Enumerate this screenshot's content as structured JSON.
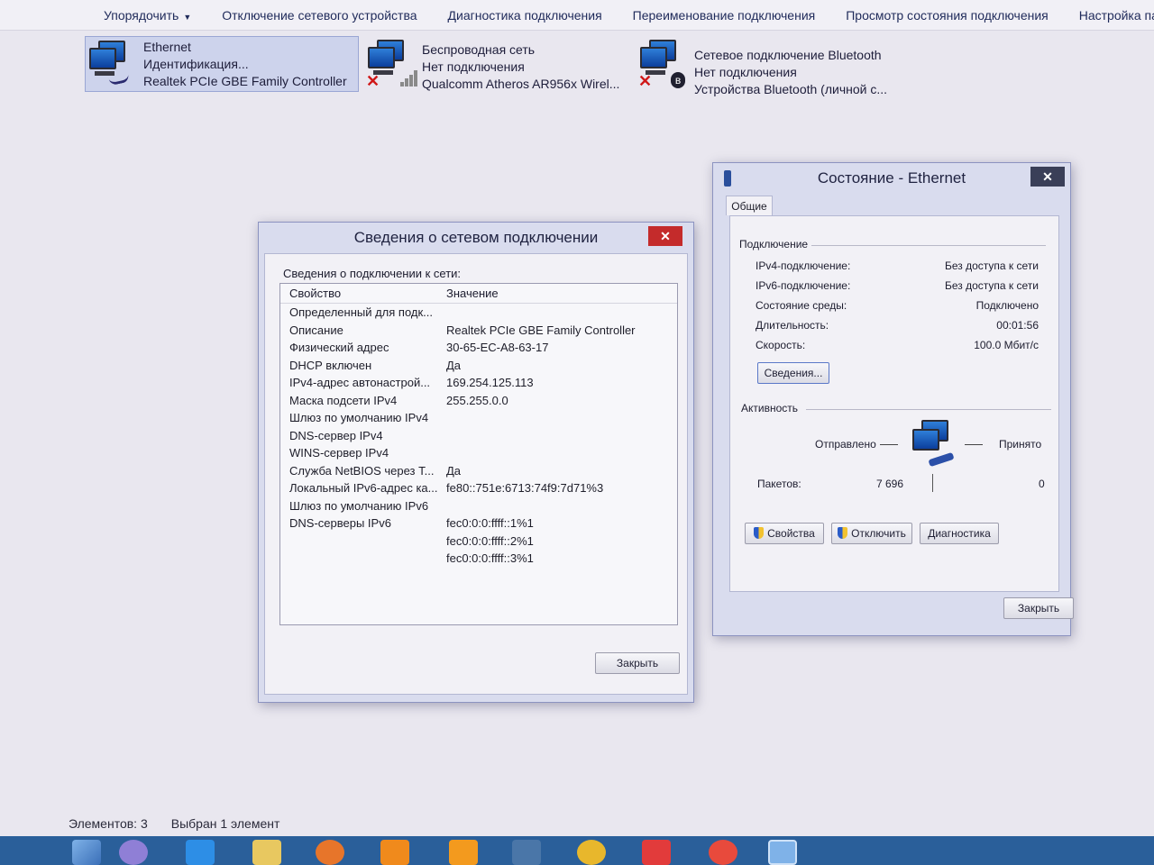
{
  "toolbar": {
    "organize": "Упорядочить",
    "disable_device": "Отключение сетевого устройства",
    "diagnose": "Диагностика подключения",
    "rename": "Переименование подключения",
    "view_status": "Просмотр состояния подключения",
    "settings": "Настройка па"
  },
  "adapters": [
    {
      "name": "Ethernet",
      "status": "Идентификация...",
      "device": "Realtek PCIe GBE Family Controller"
    },
    {
      "name": "Беспроводная сеть",
      "status": "Нет подключения",
      "device": "Qualcomm Atheros AR956x Wirel..."
    },
    {
      "name": "Сетевое подключение Bluetooth",
      "status": "Нет подключения",
      "device": "Устройства Bluetooth (личной с..."
    }
  ],
  "details_dialog": {
    "title": "Сведения о сетевом подключении",
    "close_glyph": "✕",
    "label": "Сведения о подключении к сети:",
    "col_property": "Свойство",
    "col_value": "Значение",
    "rows": [
      {
        "property": "Определенный для подк...",
        "value": ""
      },
      {
        "property": "Описание",
        "value": "Realtek PCIe GBE Family Controller"
      },
      {
        "property": "Физический адрес",
        "value": "30-65-EC-A8-63-17"
      },
      {
        "property": "DHCP включен",
        "value": "Да"
      },
      {
        "property": "IPv4-адрес автонастрой...",
        "value": "169.254.125.113"
      },
      {
        "property": "Маска подсети IPv4",
        "value": "255.255.0.0"
      },
      {
        "property": "Шлюз по умолчанию IPv4",
        "value": ""
      },
      {
        "property": "DNS-сервер IPv4",
        "value": ""
      },
      {
        "property": "WINS-сервер IPv4",
        "value": ""
      },
      {
        "property": "Служба NetBIOS через Т...",
        "value": "Да"
      },
      {
        "property": "Локальный IPv6-адрес ка...",
        "value": "fe80::751e:6713:74f9:7d71%3"
      },
      {
        "property": "Шлюз по умолчанию IPv6",
        "value": ""
      },
      {
        "property": "DNS-серверы IPv6",
        "value": "fec0:0:0:ffff::1%1"
      },
      {
        "property": "",
        "value": "fec0:0:0:ffff::2%1"
      },
      {
        "property": "",
        "value": "fec0:0:0:ffff::3%1"
      }
    ],
    "close_button": "Закрыть"
  },
  "status_window": {
    "title": "Состояние - Ethernet",
    "close_glyph": "✕",
    "tab_general": "Общие",
    "section_connection": "Подключение",
    "ipv4_label": "IPv4-подключение:",
    "ipv4_value": "Без доступа к сети",
    "ipv6_label": "IPv6-подключение:",
    "ipv6_value": "Без доступа к сети",
    "media_label": "Состояние среды:",
    "media_value": "Подключено",
    "duration_label": "Длительность:",
    "duration_value": "00:01:56",
    "speed_label": "Скорость:",
    "speed_value": "100.0 Мбит/с",
    "details_button": "Сведения...",
    "section_activity": "Активность",
    "sent_label": "Отправлено",
    "received_label": "Принято",
    "packets_label": "Пакетов:",
    "packets_sent": "7 696",
    "packets_received": "0",
    "properties_button": "Свойства",
    "disable_button": "Отключить",
    "diagnose_button": "Диагностика",
    "close_button": "Закрыть"
  },
  "statusbar": {
    "items_count": "Элементов: 3",
    "selected": "Выбран 1 элемент"
  },
  "colors": {
    "accent": "#2a5f9a",
    "close_red": "#c42b2b",
    "selection": "#cdd3ec"
  }
}
